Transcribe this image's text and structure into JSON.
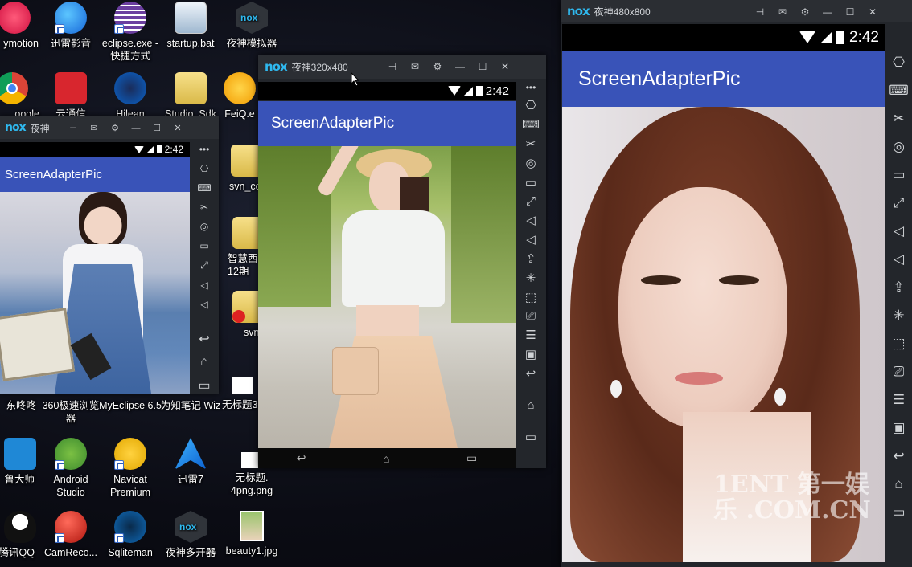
{
  "desktop": {
    "icons": [
      {
        "label": "ymotion",
        "icon": "app-icon"
      },
      {
        "label": "迅雷影音",
        "icon": "player-icon"
      },
      {
        "label": "eclipse.exe - 快捷方式",
        "icon": "eclipse-icon"
      },
      {
        "label": "startup.bat",
        "icon": "bat-file-icon"
      },
      {
        "label": "夜神模拟器",
        "icon": "nox-icon"
      },
      {
        "label": "oogle",
        "icon": "chrome-icon"
      },
      {
        "label": "云通信",
        "icon": "cloud-icon"
      },
      {
        "label": "Hilean",
        "icon": "browser-icon"
      },
      {
        "label": "Studio_Sdk",
        "icon": "folder-icon"
      },
      {
        "label": "FeiQ.e",
        "icon": "feiq-icon"
      },
      {
        "label": "svn_cc",
        "icon": "folder-icon"
      },
      {
        "label": "智慧西 12期",
        "icon": "folder-icon"
      },
      {
        "label": "svn",
        "icon": "folder-icon"
      },
      {
        "label": "东咚咚",
        "icon": "app-icon"
      },
      {
        "label": "360极速浏览器",
        "icon": "browser-icon"
      },
      {
        "label": "MyEclipse 6.5",
        "icon": "myeclipse-icon"
      },
      {
        "label": "为知笔记 Wiz",
        "icon": "wiz-icon"
      },
      {
        "label": "无标题3",
        "icon": "image-file-icon"
      },
      {
        "label": "鲁大师",
        "icon": "app-icon"
      },
      {
        "label": "Android Studio",
        "icon": "android-studio-icon"
      },
      {
        "label": "Navicat Premium",
        "icon": "navicat-icon"
      },
      {
        "label": "迅雷7",
        "icon": "thunder-icon"
      },
      {
        "label": "无标题. 4png.png",
        "icon": "image-file-icon"
      },
      {
        "label": "腾讯QQ",
        "icon": "qq-icon"
      },
      {
        "label": "CamReco...",
        "icon": "camrec-icon"
      },
      {
        "label": "Sqliteman",
        "icon": "sqliteman-icon"
      },
      {
        "label": "夜神多开器",
        "icon": "nox-multi-icon"
      },
      {
        "label": "beauty1.jpg",
        "icon": "image-file-icon"
      }
    ]
  },
  "emulator_small": {
    "logo": "nox",
    "title": "夜神",
    "time": "2:42",
    "app_title": "ScreenAdapterPic",
    "photo_desc": "girl-in-overalls-photo"
  },
  "emulator_mid": {
    "logo": "nox",
    "title": "夜神320x480",
    "time": "2:42",
    "app_title": "ScreenAdapterPic",
    "photo_desc": "girl-in-straw-hat-photo"
  },
  "emulator_large": {
    "logo": "nox",
    "title": "夜神480x800",
    "time": "2:42",
    "app_title": "ScreenAdapterPic",
    "watermark": "1ENT 第一娱乐 .COM.CN",
    "photo_desc": "woman-portrait-photo"
  },
  "title_buttons": {
    "pin": "⊣",
    "mail": "✉",
    "settings": "⚙",
    "minimize": "—",
    "maximize": "☐",
    "close": "✕"
  },
  "nav": {
    "back": "↩",
    "home": "⌂",
    "recent": "▭"
  },
  "colors": {
    "appbar": "#3953b8",
    "nox_logo": "#2fb9ef",
    "titlebar": "#2b2e33"
  }
}
